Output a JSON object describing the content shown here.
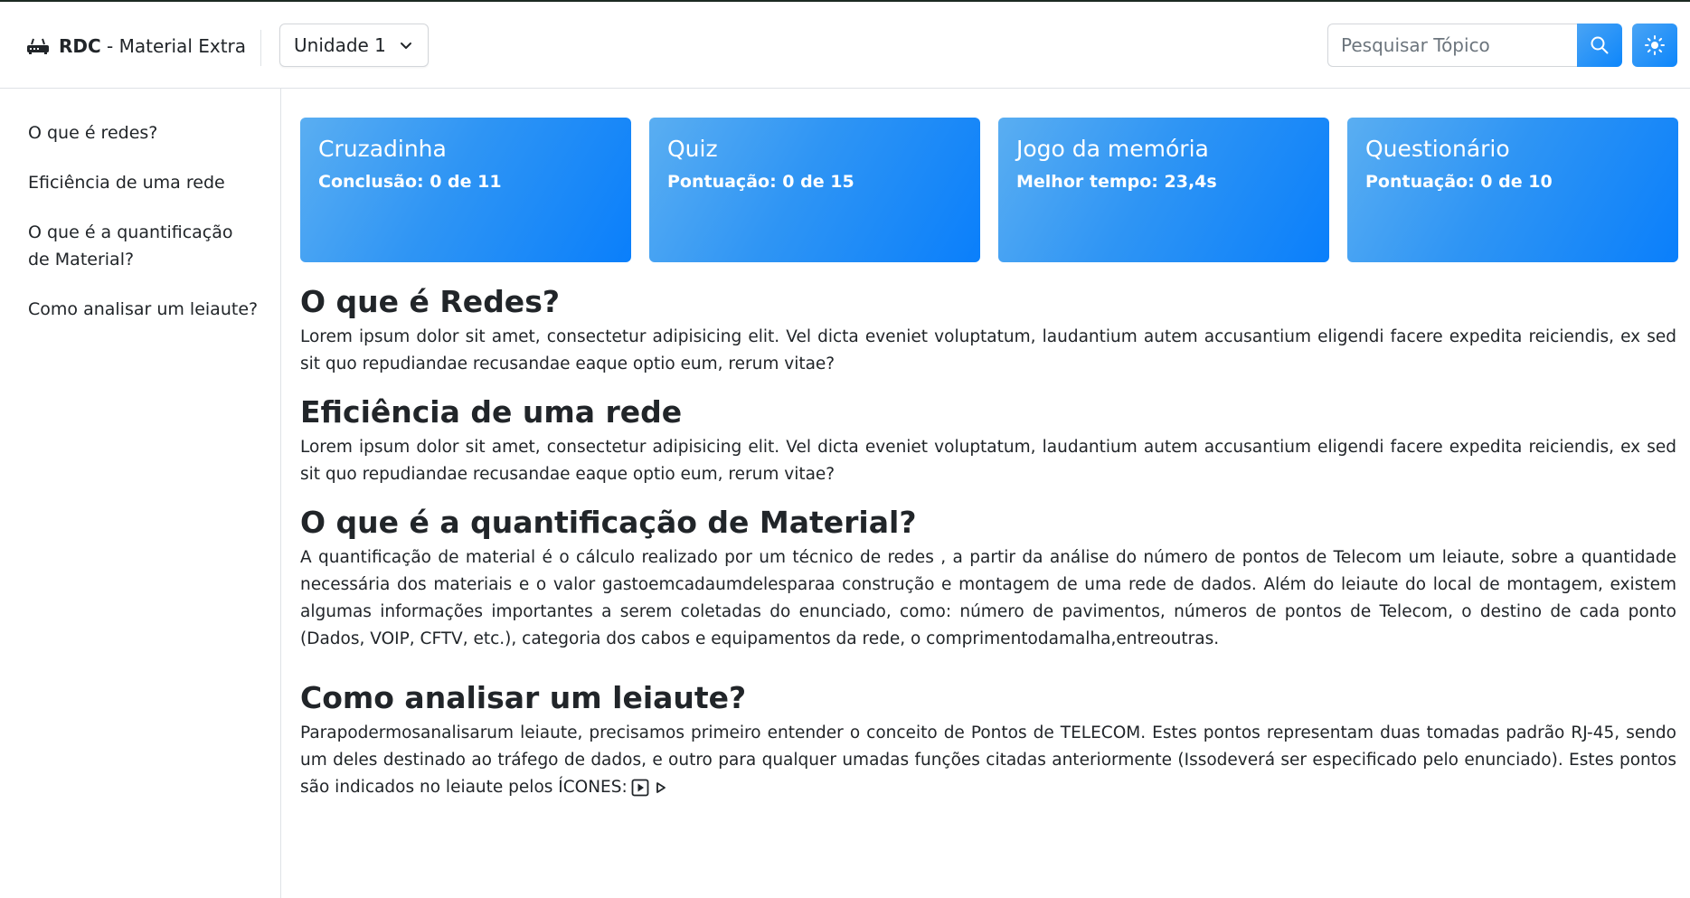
{
  "header": {
    "brand_strong": "RDC",
    "brand_rest": " - Material Extra",
    "brand_icon": "router-icon",
    "unit_select": {
      "selected": "Unidade 1"
    },
    "search": {
      "placeholder": "Pesquisar Tópico",
      "value": ""
    },
    "search_icon": "search-icon",
    "theme_icon": "sun-icon"
  },
  "sidebar": {
    "items": [
      {
        "label": "O que é redes?"
      },
      {
        "label": "Eficiência de uma rede"
      },
      {
        "label": "O que é a quantificação de Material?"
      },
      {
        "label": "Como analisar um leiaute?"
      }
    ]
  },
  "cards": [
    {
      "title": "Cruzadinha",
      "subtitle": "Conclusão: 0 de 11"
    },
    {
      "title": "Quiz",
      "subtitle": "Pontuação: 0 de 15"
    },
    {
      "title": "Jogo da memória",
      "subtitle": "Melhor tempo: 23,4s"
    },
    {
      "title": "Questionário",
      "subtitle": "Pontuação: 0 de 10"
    }
  ],
  "sections": [
    {
      "heading": "O que é Redes?",
      "body": "Lorem ipsum dolor sit amet, consectetur adipisicing elit. Vel dicta eveniet voluptatum, laudantium autem accusantium eligendi facere expedita reiciendis, ex sed sit quo repudiandae recusandae eaque optio eum, rerum vitae?"
    },
    {
      "heading": "Eficiência de uma rede",
      "body": "Lorem ipsum dolor sit amet, consectetur adipisicing elit. Vel dicta eveniet voluptatum, laudantium autem accusantium eligendi facere expedita reiciendis, ex sed sit quo repudiandae recusandae eaque optio eum, rerum vitae?"
    },
    {
      "heading": "O que é a quantificação de Material?",
      "body": "A quantificação de material é o cálculo realizado por um técnico de redes , a partir da análise do número de pontos de Telecom um leiaute, sobre a quantidade necessária dos materiais e o valor gastoemcadaumdelesparaa construção e montagem de uma rede de dados. Além do leiaute do local de montagem, existem algumas informações importantes a serem coletadas do enunciado, como: número de pavimentos, números de pontos de Telecom, o destino de cada ponto (Dados, VOIP, CFTV, etc.), categoria dos cabos e equipamentos da rede, o comprimentodamalha,entreoutras."
    },
    {
      "heading": "Como analisar um leiaute?",
      "body": " Parapodermosanalisarum leiaute, precisamos primeiro entender o conceito de Pontos de TELECOM. Estes pontos representam duas tomadas padrão RJ-45, sendo um deles destinado ao tráfego de dados, e outro para qualquer umadas funções citadas anteriormente (Issodeverá ser especificado pelo enunciado). Estes pontos são indicados no leiaute pelos ÍCONES:",
      "icons": [
        "play-square-icon",
        "play-outline-icon"
      ]
    }
  ],
  "colors": {
    "accent": "#0d86fb",
    "accent_light": "#5aaef2",
    "border": "#dee2e6",
    "text": "#212529"
  }
}
